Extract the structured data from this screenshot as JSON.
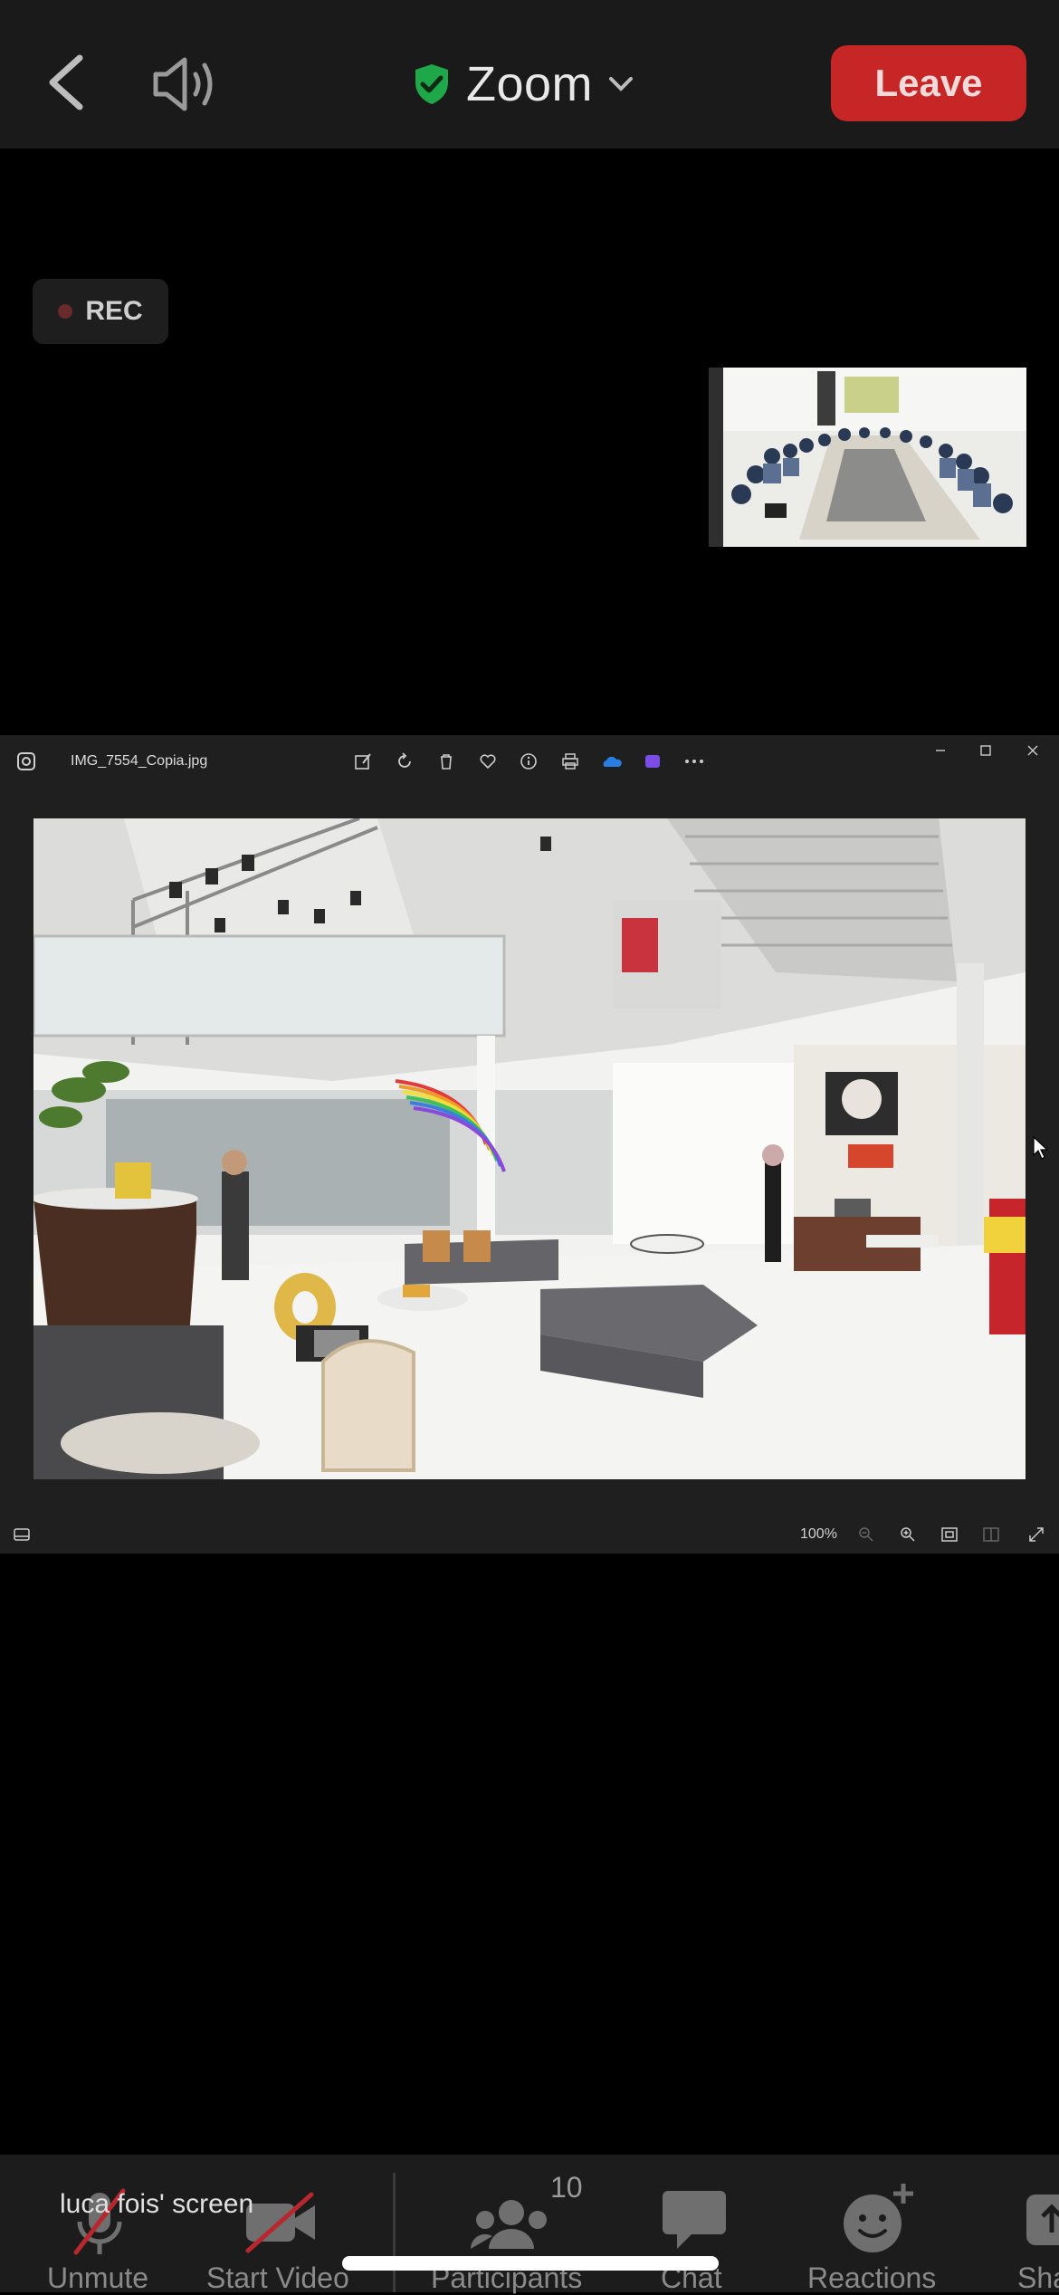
{
  "header": {
    "title": "Zoom",
    "leave_label": "Leave",
    "icons": [
      "chevron-left-icon",
      "speaker-icon",
      "shield-check-icon",
      "chevron-down-icon"
    ]
  },
  "recording": {
    "label": "REC"
  },
  "viewer": {
    "filename": "IMG_7554_Copia.jpg",
    "zoom": "100%",
    "toolbar_icons": [
      "edit-icon",
      "rotate-icon",
      "delete-icon",
      "favorite-icon",
      "info-icon",
      "print-icon",
      "onedrive-icon",
      "clipchamp-icon",
      "more-icon"
    ],
    "window_controls": [
      "minimize-icon",
      "maximize-icon",
      "close-icon"
    ]
  },
  "share": {
    "label": "luca fois' screen"
  },
  "toolbar": {
    "items": [
      {
        "label": "Unmute"
      },
      {
        "label": "Start Video"
      },
      {
        "label": "Participants",
        "count": "10"
      },
      {
        "label": "Chat"
      },
      {
        "label": "Reactions"
      },
      {
        "label": "Sha"
      }
    ]
  },
  "colors": {
    "leave": "#c62626",
    "shield": "#1fa84a",
    "background": "#000000"
  }
}
